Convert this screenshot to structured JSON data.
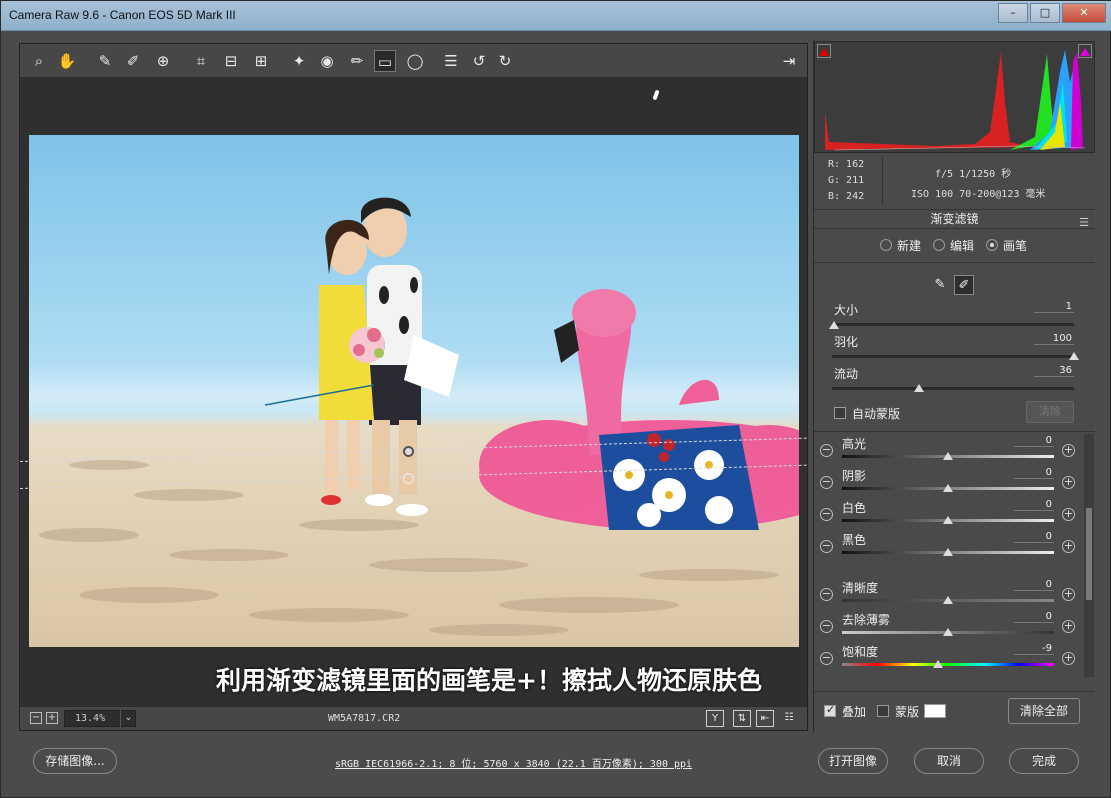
{
  "window": {
    "title": "Camera Raw 9.6 -  Canon EOS 5D Mark III"
  },
  "toolbar": {
    "tools": [
      "zoom-icon",
      "hand-icon",
      "white-balance-icon",
      "color-sampler-icon",
      "targeted-adjust-icon",
      "crop-icon",
      "straighten-icon",
      "transform-icon",
      "spot-removal-icon",
      "red-eye-icon",
      "adjustment-brush-icon",
      "graduated-filter-icon",
      "radial-filter-icon",
      "preferences-icon",
      "rotate-left-icon",
      "rotate-right-icon"
    ],
    "fullscreen_icon": "fullscreen-icon"
  },
  "canvas": {
    "caption": "利用渐变滤镜里面的画笔是+！擦拭人物还原肤色"
  },
  "statusbar": {
    "zoom": "13.4%",
    "filename": "WM5A7817.CR2"
  },
  "readout": {
    "r": "R:  162",
    "g": "G:  211",
    "b": "B:  242",
    "exposure": "f/5  1/1250 秒",
    "iso_lens": "ISO 100  70-200@123 毫米"
  },
  "panel": {
    "title": "渐变滤镜",
    "modes": {
      "new": "新建",
      "edit": "编辑",
      "brush": "画笔",
      "selected": "brush"
    },
    "brush": {
      "size": {
        "label": "大小",
        "value": "1",
        "level": 0.01
      },
      "feather": {
        "label": "羽化",
        "value": "100",
        "level": 1.0
      },
      "flow": {
        "label": "流动",
        "value": "36",
        "level": 0.36
      }
    },
    "auto_mask": {
      "label": "自动蒙版",
      "checked": false
    },
    "clear": "清除",
    "adjustments": [
      {
        "label": "高光",
        "value": "0"
      },
      {
        "label": "阴影",
        "value": "0"
      },
      {
        "label": "白色",
        "value": "0"
      },
      {
        "label": "黑色",
        "value": "0"
      },
      {
        "label": "清晰度",
        "value": "0"
      },
      {
        "label": "去除薄雾",
        "value": "0"
      },
      {
        "label": "饱和度",
        "value": "-9"
      }
    ],
    "overlay": {
      "label": "叠加",
      "checked": true
    },
    "mask": {
      "label": "蒙版",
      "checked": false
    },
    "clear_all": "清除全部"
  },
  "footer": {
    "save": "存储图像...",
    "info": "sRGB IEC61966-2.1; 8 位; 5760 x 3840 (22.1 百万像素); 300 ppi",
    "open": "打开图像",
    "cancel": "取消",
    "done": "完成"
  },
  "colors": {
    "accent_red": "#e00000",
    "accent_magenta": "#e000e0"
  }
}
